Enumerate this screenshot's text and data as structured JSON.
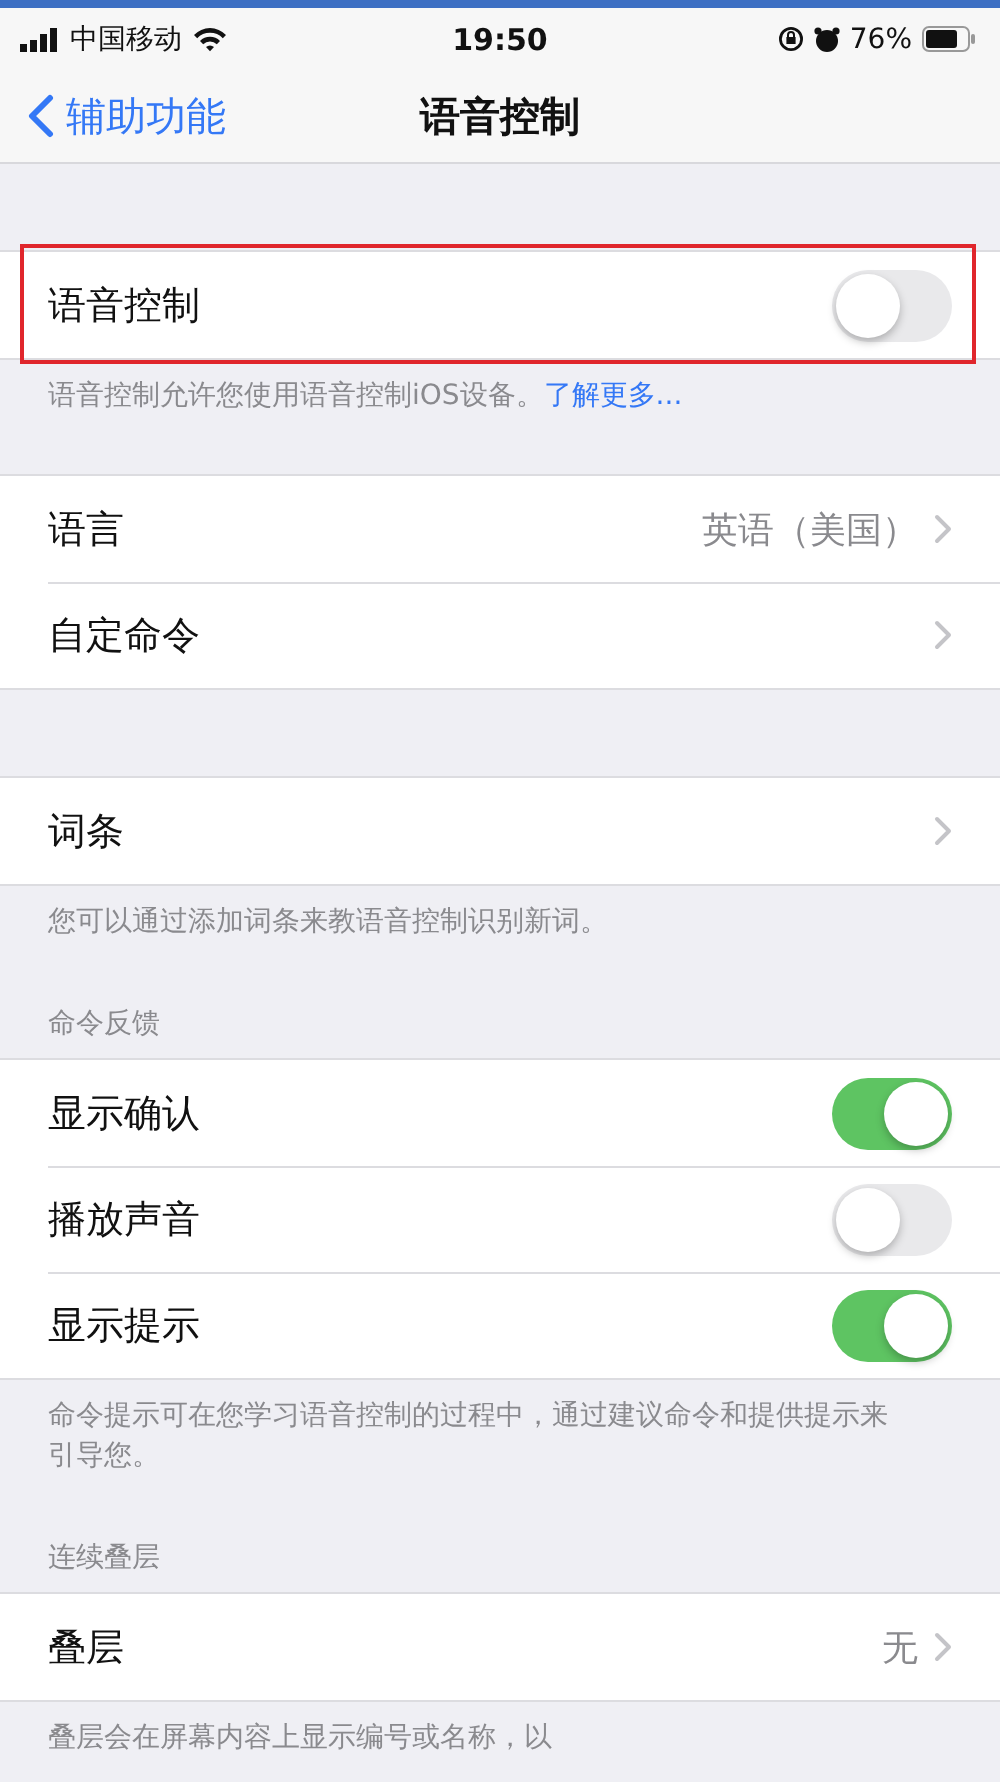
{
  "status_bar": {
    "carrier": "中国移动",
    "time": "19:50",
    "battery": "76%"
  },
  "nav": {
    "back": "辅助功能",
    "title": "语音控制"
  },
  "sections": [
    {
      "highlighted": true,
      "rows": [
        {
          "kind": "toggle",
          "label": "语音控制",
          "on": false
        }
      ],
      "footer": {
        "text": "语音控制允许您使用语音控制iOS设备。",
        "link": "了解更多..."
      }
    },
    {
      "highlighted": false,
      "rows": [
        {
          "kind": "value",
          "label": "语言",
          "value": "英语（美国）"
        },
        {
          "kind": "link",
          "label": "自定命令"
        }
      ]
    },
    {
      "highlighted": false,
      "rows": [
        {
          "kind": "link",
          "label": "词条"
        }
      ],
      "footer": {
        "text": "您可以通过添加词条来教语音控制识别新词。"
      }
    },
    {
      "highlighted": false,
      "header": "命令反馈",
      "rows": [
        {
          "kind": "toggle",
          "label": "显示确认",
          "on": true
        },
        {
          "kind": "toggle",
          "label": "播放声音",
          "on": false
        },
        {
          "kind": "toggle",
          "label": "显示提示",
          "on": true
        }
      ],
      "footer": {
        "text": "命令提示可在您学习语音控制的过程中，通过建议命令和提供提示来引导您。"
      }
    },
    {
      "highlighted": false,
      "header": "连续叠层",
      "rows": [
        {
          "kind": "value",
          "label": "叠层",
          "value": "无"
        }
      ],
      "footer": {
        "text": "叠层会在屏幕内容上显示编号或名称，以"
      }
    }
  ]
}
